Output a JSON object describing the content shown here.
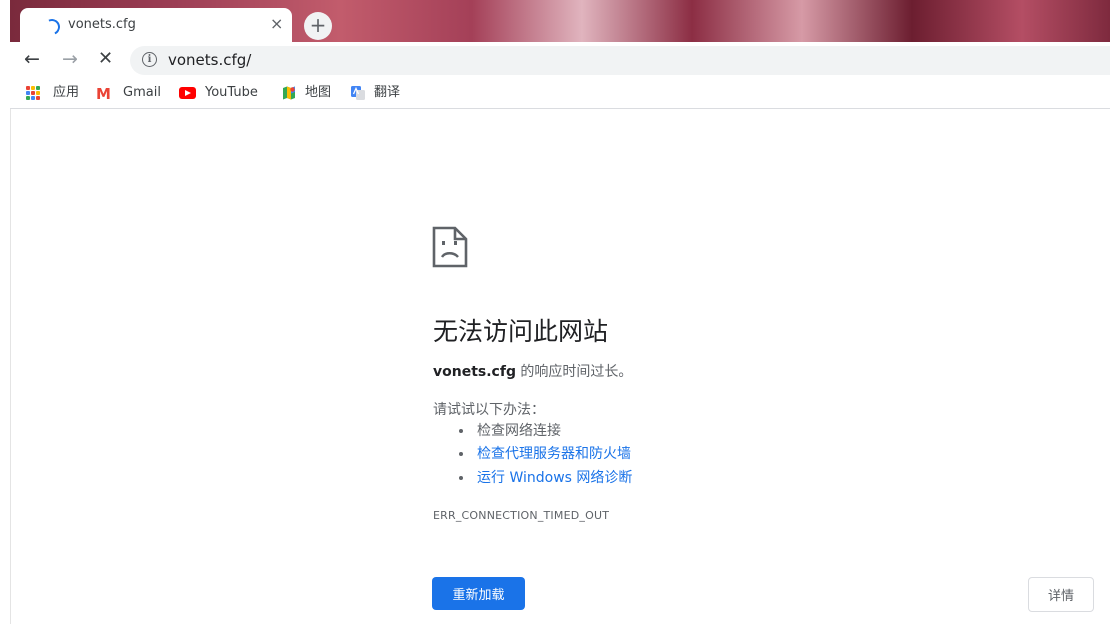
{
  "tab": {
    "title": "vonets.cfg",
    "close_glyph": "×"
  },
  "new_tab_glyph": "+",
  "nav": {
    "back_glyph": "←",
    "forward_glyph": "→",
    "stop_glyph": "✕"
  },
  "address": {
    "info_glyph": "i",
    "url": "vonets.cfg/"
  },
  "bookmarks": [
    {
      "label": "应用",
      "icon": "apps-grid-icon"
    },
    {
      "label": "Gmail",
      "icon": "gmail-icon",
      "icon_glyph": "M"
    },
    {
      "label": "YouTube",
      "icon": "youtube-icon"
    },
    {
      "label": "地图",
      "icon": "maps-icon"
    },
    {
      "label": "翻译",
      "icon": "translate-icon"
    }
  ],
  "error": {
    "title": "无法访问此网站",
    "host": "vonets.cfg",
    "message_suffix": " 的响应时间过长。",
    "try_label": "请试试以下办法：",
    "suggestions": [
      {
        "text": "检查网络连接",
        "link": false
      },
      {
        "text": "检查代理服务器和防火墙",
        "link": true
      },
      {
        "text": "运行 Windows 网络诊断",
        "link": true
      }
    ],
    "code": "ERR_CONNECTION_TIMED_OUT"
  },
  "buttons": {
    "reload": "重新加载",
    "details": "详情"
  },
  "colors": {
    "accent": "#1a73e8",
    "text": "#202124",
    "secondary": "#5f6368"
  }
}
